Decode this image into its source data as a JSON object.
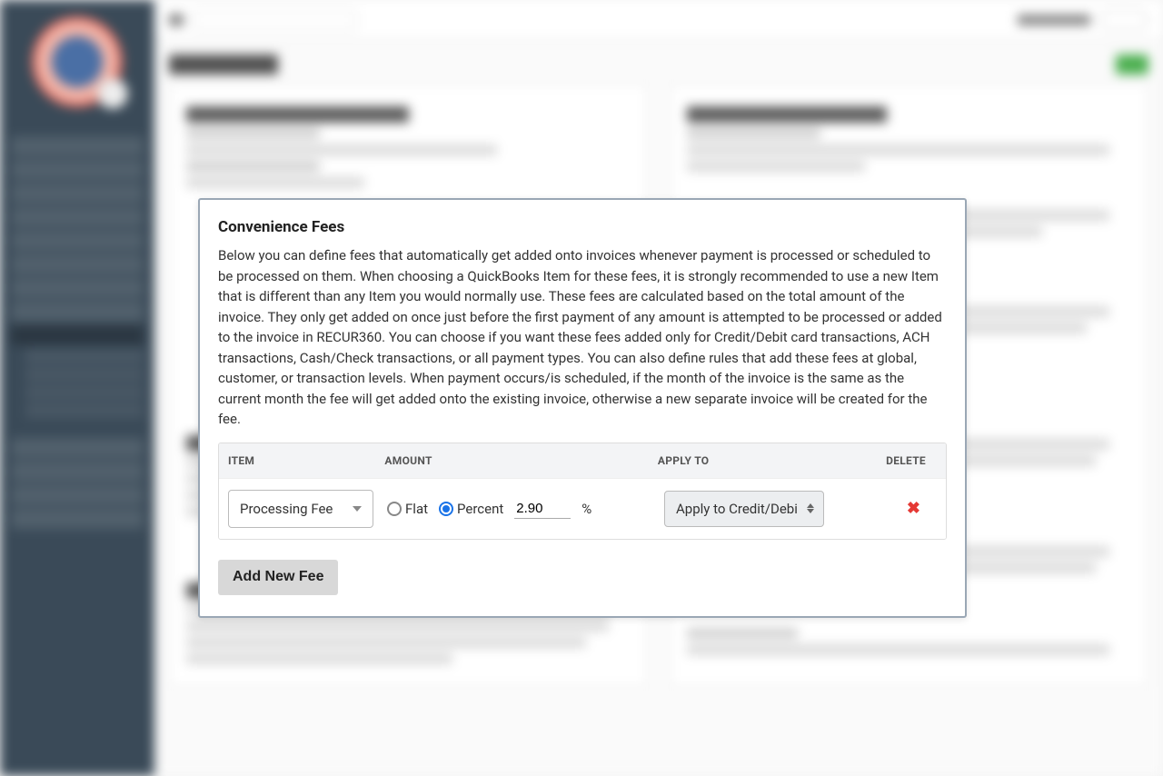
{
  "modal": {
    "title": "Convenience Fees",
    "description": "Below you can define fees that automatically get added onto invoices whenever payment is processed or scheduled to be processed on them. When choosing a QuickBooks Item for these fees, it is strongly recommended to use a new Item that is different than any Item you would normally use. These fees are calculated based on the total amount of the invoice. They only get added on once just before the first payment of any amount is attempted to be processed or added to the invoice in RECUR360. You can choose if you want these fees added only for Credit/Debit card transactions, ACH transactions, Cash/Check transactions, or all payment types. You can also define rules that add these fees at global, customer, or transaction levels. When payment occurs/is scheduled, if the month of the invoice is the same as the current month the fee will get added onto the existing invoice, otherwise a new separate invoice will be created for the fee.",
    "columns": {
      "item": "ITEM",
      "amount": "AMOUNT",
      "apply_to": "APPLY TO",
      "delete": "DELETE"
    },
    "row": {
      "item_selected": "Processing Fee",
      "flat_label": "Flat",
      "percent_label": "Percent",
      "amount_value": "2.90",
      "percent_symbol": "%",
      "apply_selected": "Apply to Credit/Debi",
      "delete_icon": "✖"
    },
    "add_button": "Add New Fee"
  }
}
